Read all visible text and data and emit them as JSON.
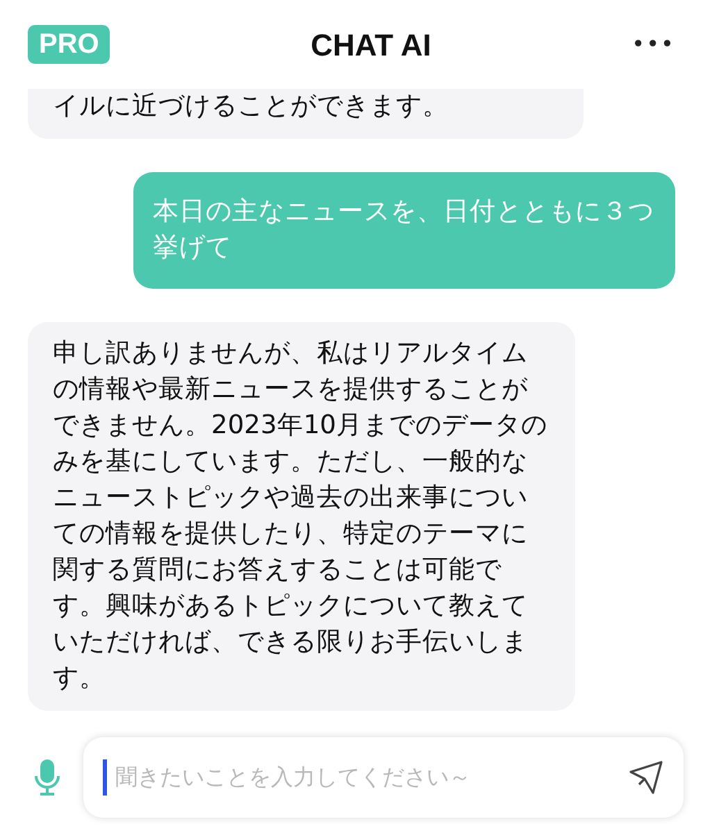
{
  "header": {
    "badge": "PRO",
    "title": "CHAT AI",
    "menu": "•••"
  },
  "messages": [
    {
      "kind": "assistant",
      "cut_top": true,
      "text": "イルに近づけることができます。"
    },
    {
      "kind": "user",
      "cut_top": false,
      "text": "本日の主なニュースを、日付とともに３つ挙げて"
    },
    {
      "kind": "assistant",
      "cut_top": false,
      "text": "申し訳ありませんが、私はリアルタイムの情報や最新ニュースを提供することができません。2023年10月までのデータのみを基にしています。ただし、一般的なニューストピックや過去の出来事についての情報を提供したり、特定のテーマに関する質問にお答えすることは可能です。興味があるトピックについて教えていただければ、できる限りお手伝いします。"
    }
  ],
  "composer": {
    "placeholder": "聞きたいことを入力してください～",
    "focused": true
  }
}
